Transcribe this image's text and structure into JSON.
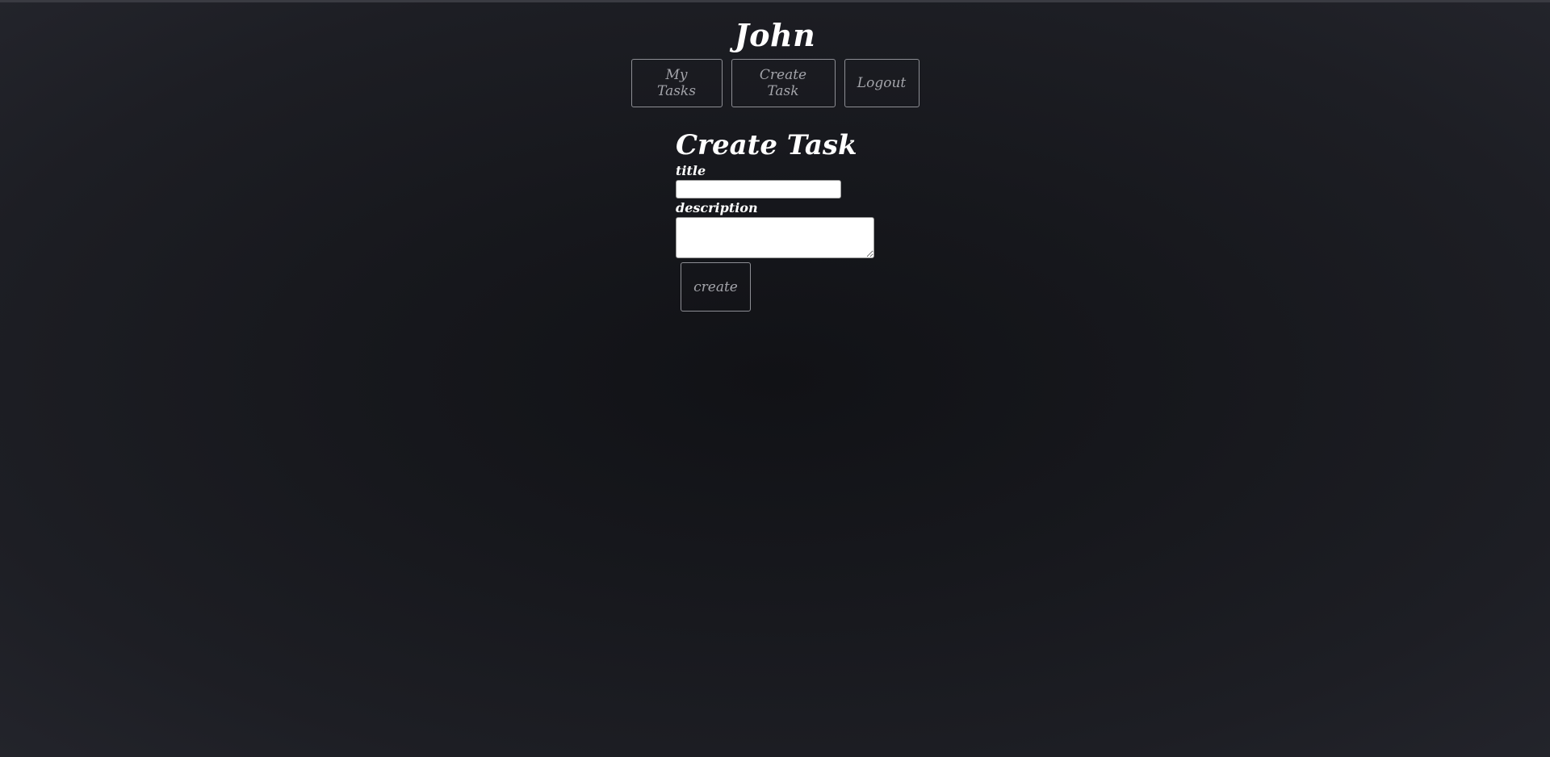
{
  "header": {
    "user_name": "John"
  },
  "nav": {
    "items": [
      {
        "label": "My Tasks"
      },
      {
        "label": "Create Task"
      },
      {
        "label": "Logout"
      }
    ]
  },
  "form": {
    "heading": "Create Task",
    "title_label": "title",
    "title_value": "",
    "description_label": "description",
    "description_value": "",
    "submit_label": "create"
  },
  "colors": {
    "background": "#17181d",
    "text": "#ffffff",
    "button_text": "#a3a4aa",
    "button_border": "#8d8e94"
  }
}
